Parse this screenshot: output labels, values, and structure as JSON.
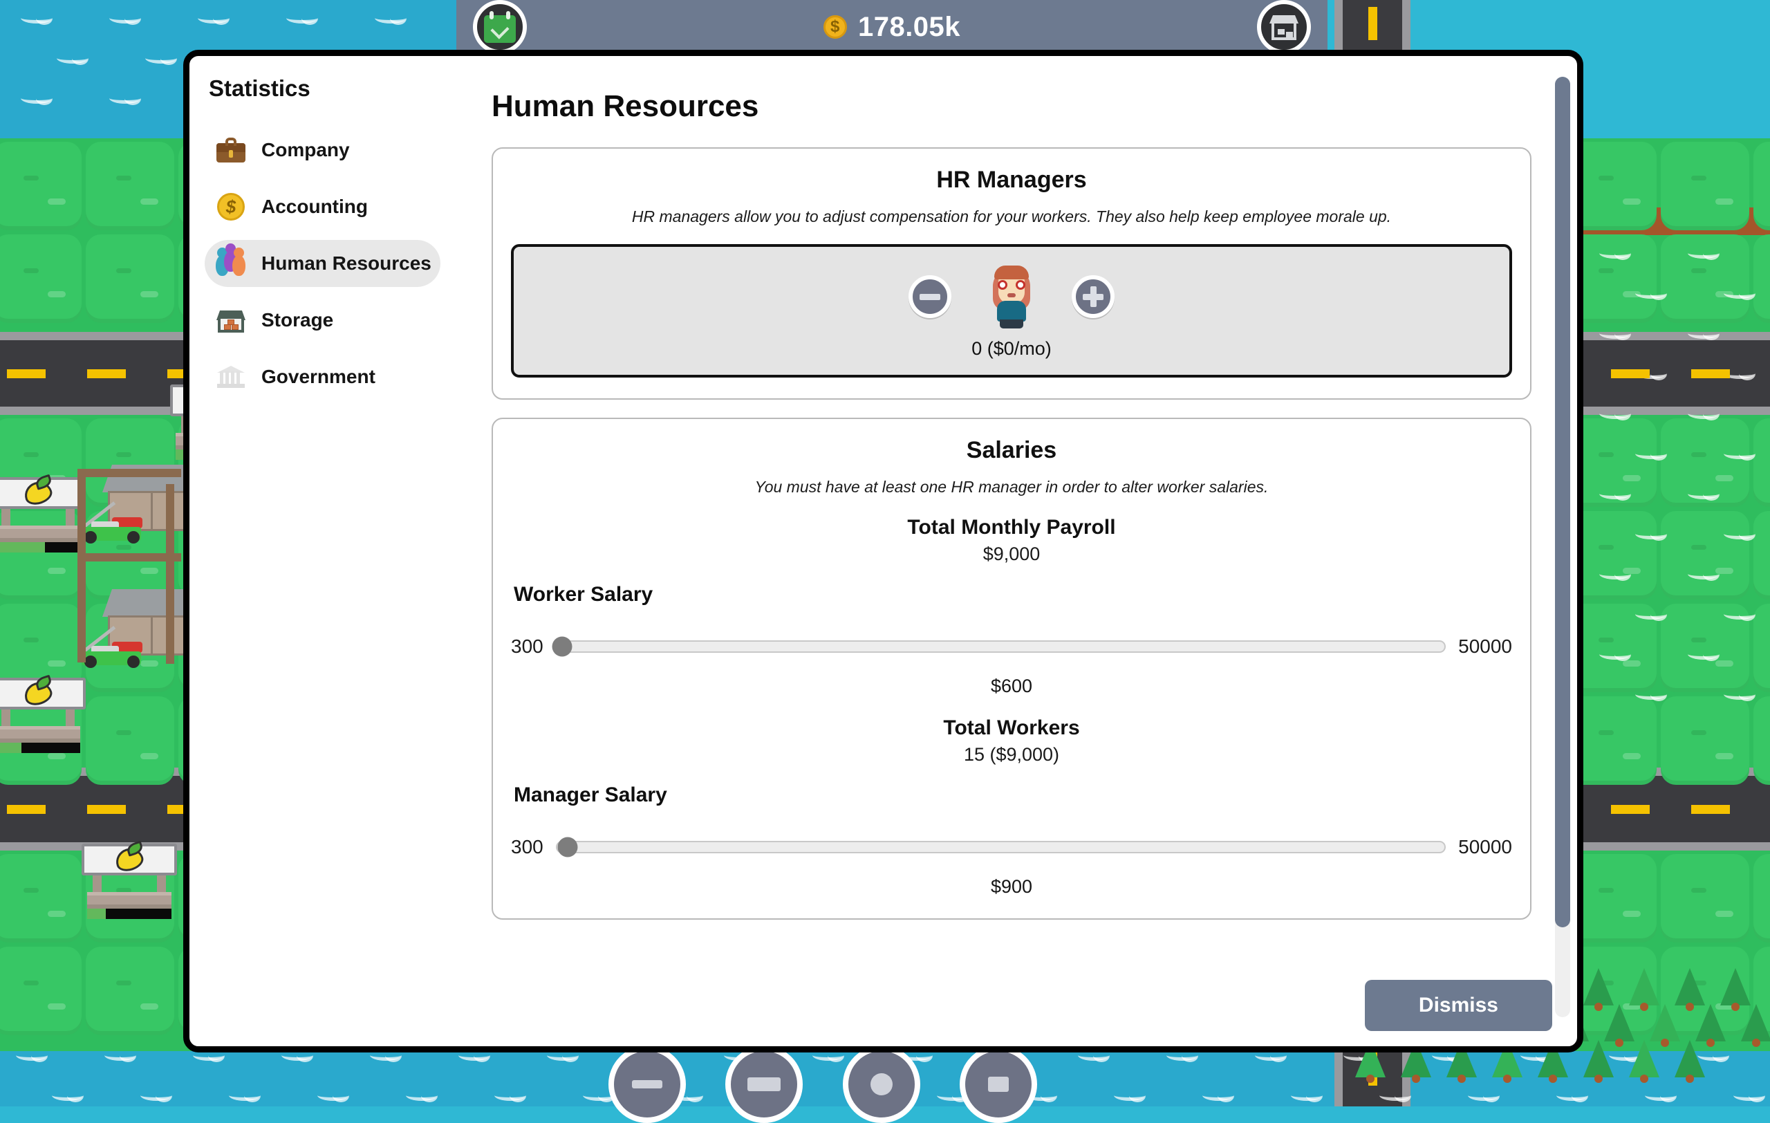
{
  "hud": {
    "money": "178.05k",
    "coin_icon": "coin-icon",
    "left_icon": "calendar-check-icon",
    "right_icon": "warehouse-icon",
    "dock_buttons": [
      {
        "icon": "minus-tool-icon"
      },
      {
        "icon": "grid-tool-icon"
      },
      {
        "icon": "circle-tool-icon"
      },
      {
        "icon": "square-tool-icon"
      }
    ]
  },
  "dialog": {
    "title": "Statistics",
    "dismiss_label": "Dismiss"
  },
  "sidebar": {
    "items": [
      {
        "label": "Company",
        "icon": "briefcase-icon",
        "active": false
      },
      {
        "label": "Accounting",
        "icon": "dollar-coin-icon",
        "active": false
      },
      {
        "label": "Human Resources",
        "icon": "people-icon",
        "active": true
      },
      {
        "label": "Storage",
        "icon": "warehouse-icon",
        "active": false
      },
      {
        "label": "Government",
        "icon": "bank-icon",
        "active": false
      }
    ]
  },
  "main": {
    "heading": "Human Resources",
    "hr_managers": {
      "title": "HR Managers",
      "description": "HR managers allow you to adjust compensation for your workers. They also help keep employee morale up.",
      "decrement_icon": "minus-icon",
      "increment_icon": "plus-icon",
      "avatar_icon": "hr-manager-avatar",
      "count_label": "0 ($0/mo)"
    },
    "salaries": {
      "title": "Salaries",
      "description": "You must have at least one HR manager in order to alter worker salaries.",
      "total_payroll_label": "Total Monthly Payroll",
      "total_payroll_value": "$9,000",
      "worker": {
        "heading": "Worker Salary",
        "min_label": "300",
        "max_label": "50000",
        "value_label": "$600",
        "min": 300,
        "max": 50000,
        "value": 600
      },
      "total_workers_label": "Total Workers",
      "total_workers_value": "15 ($9,000)",
      "manager": {
        "heading": "Manager Salary",
        "min_label": "300",
        "max_label": "50000",
        "value_label": "$900",
        "min": 300,
        "max": 50000,
        "value": 900
      }
    }
  },
  "colors": {
    "accent_slate": "#6d7a90",
    "panel_gray": "#e4e4e4",
    "water": "#2aa9cd",
    "grass": "#37c765",
    "road": "#3b3b3f",
    "road_dash": "#f5c200",
    "coin": "#f1b31c"
  }
}
